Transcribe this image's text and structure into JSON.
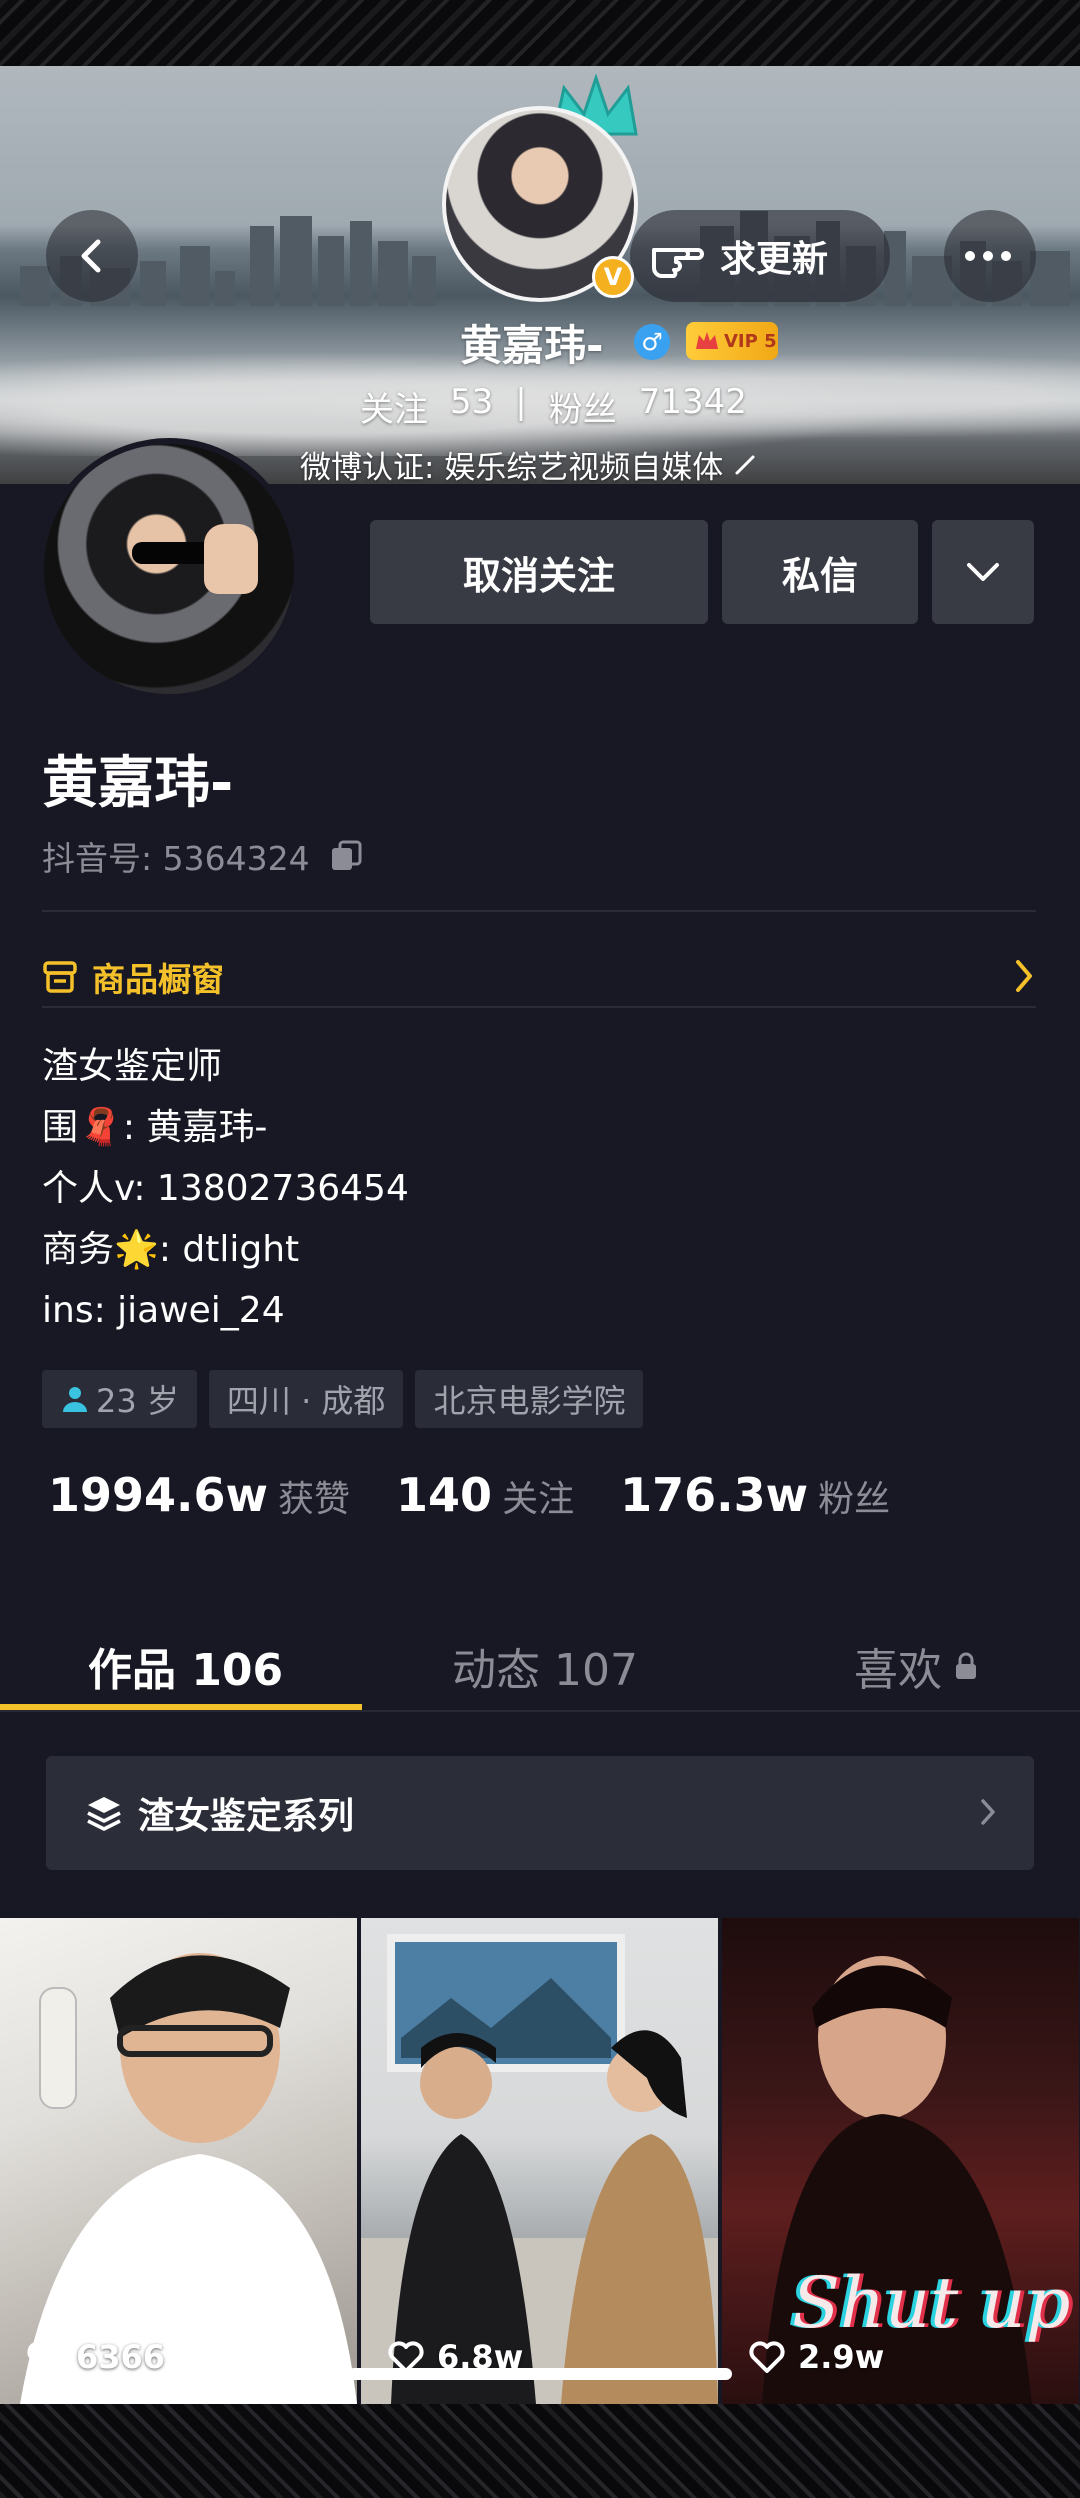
{
  "header": {
    "update_label": "求更新",
    "name": "黄嘉玮-",
    "vip_label": "VIP 5",
    "following_label": "关注",
    "following_count": "53",
    "separator": "|",
    "fans_label": "粉丝",
    "fans_count": "71342",
    "certification": "微博认证: 娱乐综艺视频自媒体"
  },
  "actions": {
    "unfollow_label": "取消关注",
    "message_label": "私信"
  },
  "profile": {
    "name": "黄嘉玮-",
    "douyin_id": "抖音号: 5364324"
  },
  "shop": {
    "label": "商品橱窗"
  },
  "bio": {
    "line1": "渣女鉴定师",
    "line2_prefix": "围",
    "line2_value": ": 黄嘉玮-",
    "line3": "个人v: 13802736454",
    "line4_prefix": "商务",
    "line4_value": ": dtlight",
    "line5": "ins: jiawei_24"
  },
  "tags": {
    "age": "23 岁",
    "location": "四川 · 成都",
    "school": "北京电影学院"
  },
  "stats": {
    "likes_value": "1994.6w",
    "likes_label": "获赞",
    "following_value": "140",
    "following_label": "关注",
    "fans_value": "176.3w",
    "fans_label": "粉丝"
  },
  "tabs": {
    "works": "作品 106",
    "dynamic": "动态 107",
    "likes": "喜欢"
  },
  "series": {
    "label": "渣女鉴定系列"
  },
  "videos": [
    {
      "likes": "6366"
    },
    {
      "likes": "6.8w"
    },
    {
      "likes": "2.9w",
      "overlay_text": "Shut up"
    }
  ],
  "colors": {
    "accent": "#f5c12a",
    "background": "#171823",
    "button": "#393b44",
    "muted_text": "#8b8c96"
  }
}
